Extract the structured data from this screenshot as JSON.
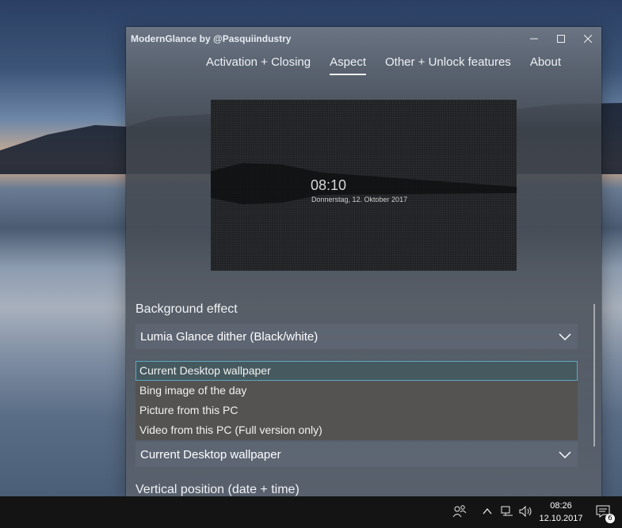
{
  "window": {
    "title": "ModernGlance by @Pasquiindustry",
    "minimize": "—",
    "maximize": "☐",
    "close": "✕"
  },
  "tabs": [
    {
      "label": "Activation + Closing"
    },
    {
      "label": "Aspect",
      "active": true
    },
    {
      "label": "Other + Unlock features"
    },
    {
      "label": "About"
    }
  ],
  "preview": {
    "time": "08:10",
    "date": "Donnerstag, 12. Oktober 2017"
  },
  "background_effect": {
    "label": "Background effect",
    "value": "Lumia Glance dither (Black/white)"
  },
  "background_source": {
    "options": [
      "Current Desktop wallpaper",
      "Bing image of the day",
      "Picture from this PC",
      "Video from this PC (Full version only)"
    ],
    "selected_index": 0,
    "value": "Current Desktop wallpaper"
  },
  "vertical_position": {
    "label": "Vertical position (date + time)"
  },
  "taskbar": {
    "time": "08:26",
    "date": "12.10.2017",
    "notification_count": "6",
    "icons": [
      "people-icon",
      "chevron-up-icon",
      "network-icon",
      "volume-icon",
      "action-center-icon"
    ]
  },
  "colors": {
    "selection_border": "#5aa8c4",
    "dropdown_bg": "#545351",
    "taskbar_bg": "#141414"
  }
}
